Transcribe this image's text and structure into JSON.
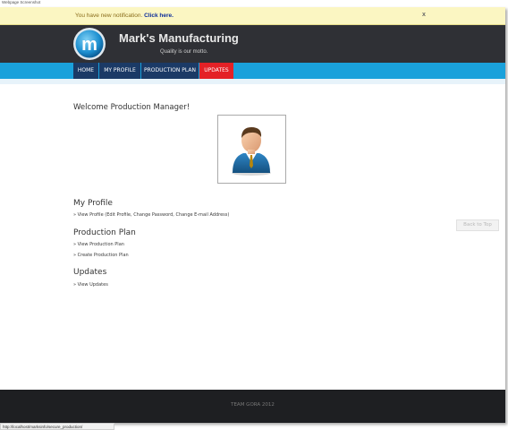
{
  "screenshot_caption": "Webpage Screenshot",
  "notification": {
    "message": "You have new notification. ",
    "link": "Click here.",
    "close": "x"
  },
  "header": {
    "brand": "Mark's Manufacturing",
    "motto": "Quality is our motto.",
    "logo_letter": "m"
  },
  "nav": {
    "items": [
      {
        "label": "HOME"
      },
      {
        "label": "MY PROFILE"
      },
      {
        "label": "PRODUCTION PLAN"
      },
      {
        "label": "UPDATES"
      }
    ],
    "active": "UPDATES",
    "active_color": "#e42126",
    "bar_color": "#1aa1db"
  },
  "main": {
    "welcome": "Welcome Production Manager!",
    "sections": [
      {
        "title": "My Profile",
        "links": [
          "» View Profile (Edit Profile, Change Password, Change E-mail Address)"
        ]
      },
      {
        "title": "Production Plan",
        "links": [
          "» View Production Plan",
          "» Create Production Plan"
        ]
      },
      {
        "title": "Updates",
        "links": [
          "» View Updates"
        ]
      }
    ],
    "back_to_top": "Back to Top"
  },
  "footer": {
    "text": "TEAM GORA 2012"
  },
  "statusbar": {
    "url": "http://localhost/marksinfo/secure_production/"
  }
}
